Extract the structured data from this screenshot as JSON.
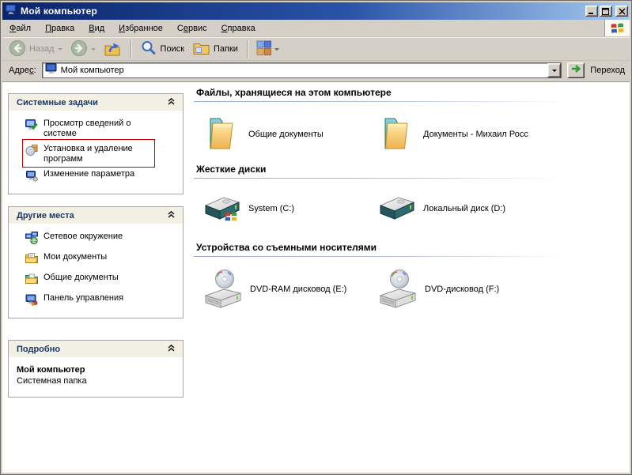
{
  "window": {
    "title": "Мой компьютер"
  },
  "menu": {
    "items": [
      {
        "pre": "",
        "u": "Ф",
        "post": "айл"
      },
      {
        "pre": "",
        "u": "П",
        "post": "равка"
      },
      {
        "pre": "",
        "u": "В",
        "post": "ид"
      },
      {
        "pre": "",
        "u": "И",
        "post": "збранное"
      },
      {
        "pre": "С",
        "u": "е",
        "post": "рвис"
      },
      {
        "pre": "",
        "u": "С",
        "post": "правка"
      }
    ]
  },
  "toolbar": {
    "back_label": "Назад",
    "search_label": "Поиск",
    "folders_label": "Папки"
  },
  "addressbar": {
    "label_pre": "Адре",
    "label_mnemonic": "с",
    "label_post": ":",
    "value": "Мой компьютер",
    "go_label": "Переход"
  },
  "sidebar": {
    "panels": [
      {
        "title": "Системные задачи",
        "items": [
          {
            "label": "Просмотр сведений о системе"
          },
          {
            "label": "Установка и удаление программ",
            "highlighted": true
          },
          {
            "label": "Изменение параметра"
          }
        ]
      },
      {
        "title": "Другие места",
        "items": [
          {
            "label": "Сетевое окружение"
          },
          {
            "label": "Мои документы"
          },
          {
            "label": "Общие документы"
          },
          {
            "label": "Панель управления"
          }
        ]
      },
      {
        "title": "Подробно",
        "details_title": "Мой компьютер",
        "details_subtitle": "Системная папка"
      }
    ]
  },
  "main": {
    "sections": [
      {
        "header": "Файлы, хранящиеся на этом компьютере",
        "items": [
          {
            "label": "Общие документы"
          },
          {
            "label": "Документы - Михаил Росс"
          }
        ]
      },
      {
        "header": "Жесткие диски",
        "items": [
          {
            "label": "System (C:)"
          },
          {
            "label": "Локальный диск (D:)"
          }
        ]
      },
      {
        "header": "Устройства со съемными носителями",
        "items": [
          {
            "label": "DVD-RAM дисковод (E:)"
          },
          {
            "label": "DVD-дисковод (F:)"
          }
        ]
      }
    ]
  },
  "colors": {
    "titlebar_start": "#0a246a",
    "titlebar_end": "#a6caf0",
    "chrome": "#d4d0c8",
    "panel_header_text": "#1c3663",
    "highlight_red": "#cc0000"
  }
}
